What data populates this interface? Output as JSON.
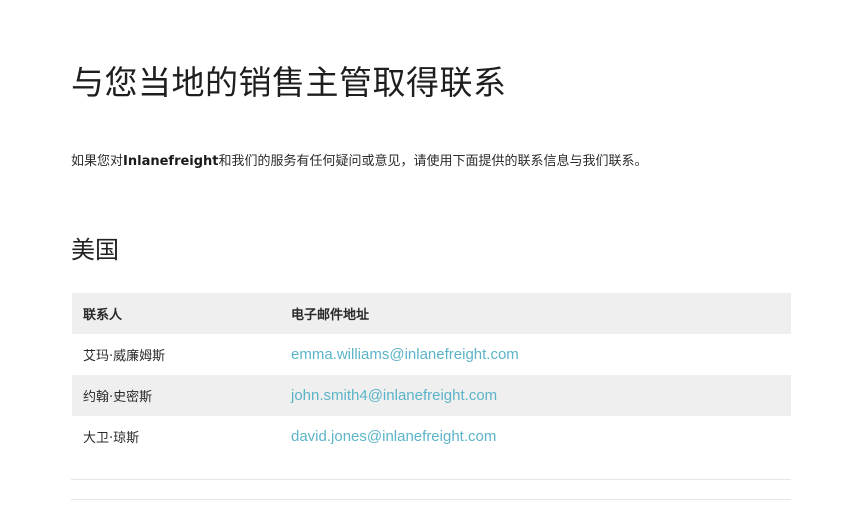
{
  "page_title": "与您当地的销售主管取得联系",
  "intro": {
    "prefix": "如果您对",
    "brand": "Inlanefreight",
    "suffix": "和我们的服务有任何疑问或意见，请使用下面提供的联系信息与我们联系。"
  },
  "section": {
    "title": "美国"
  },
  "table": {
    "headers": {
      "name": "联系人",
      "email": "电子邮件地址"
    },
    "rows": [
      {
        "name": "艾玛·威廉姆斯",
        "email": "emma.williams@inlanefreight.com"
      },
      {
        "name": "约翰·史密斯",
        "email": "john.smith4@inlanefreight.com"
      },
      {
        "name": "大卫·琼斯",
        "email": "david.jones@inlanefreight.com"
      }
    ]
  },
  "colors": {
    "link": "#5bb4c8",
    "header_bg": "#efefef",
    "text": "#222222"
  }
}
